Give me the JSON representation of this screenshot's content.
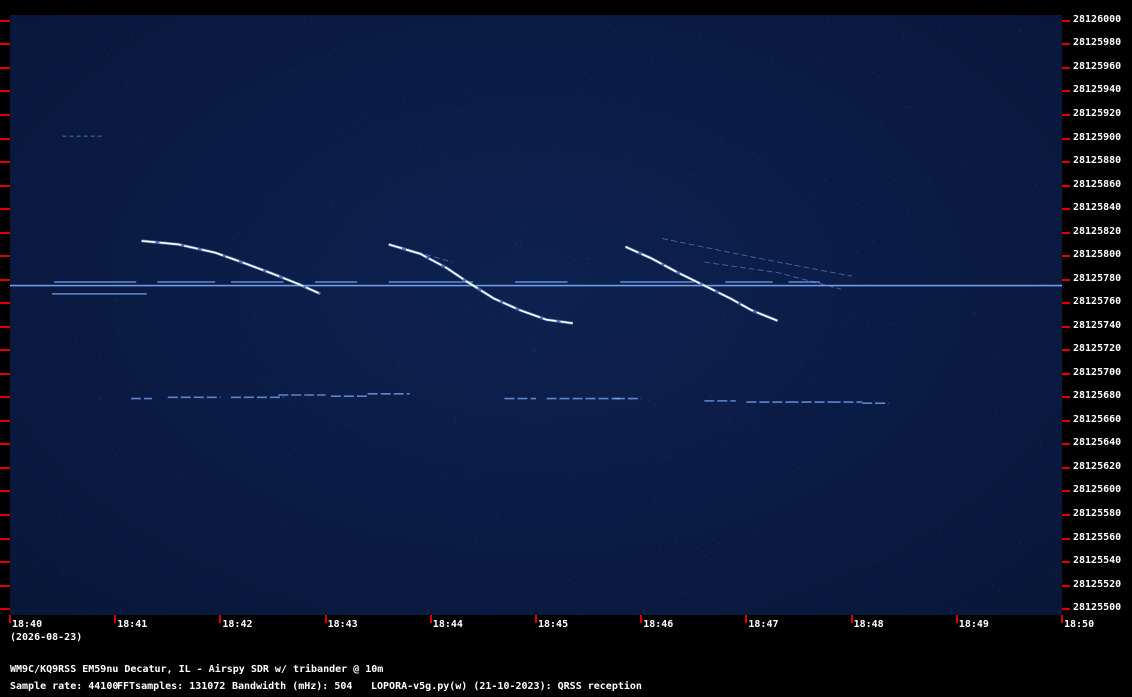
{
  "chart_data": {
    "type": "scatter",
    "x_ticks": [
      "18:40",
      "18:41",
      "18:42",
      "18:43",
      "18:44",
      "18:45",
      "18:46",
      "18:47",
      "18:48",
      "18:49",
      "18:50"
    ],
    "x_date": "(2026-08-23)",
    "y_ticks": [
      28126000,
      28125980,
      28125960,
      28125940,
      28125920,
      28125900,
      28125880,
      28125860,
      28125840,
      28125820,
      28125800,
      28125780,
      28125760,
      28125740,
      28125720,
      28125700,
      28125680,
      28125660,
      28125640,
      28125620,
      28125600,
      28125580,
      28125560,
      28125540,
      28125520,
      28125500
    ],
    "ylim": [
      28125495,
      28126005
    ],
    "xlim": [
      0,
      10
    ],
    "colors": {
      "background": "#0a1b44",
      "signal": "#7fb2ff",
      "bright": "#ffffff",
      "tick": "#e00000"
    },
    "carrier": {
      "freq": 28125775,
      "x_start": 0,
      "x_end": 10
    },
    "carrier_keying": [
      {
        "x0": 0.42,
        "x1": 1.2,
        "freq": 28125778
      },
      {
        "x0": 1.4,
        "x1": 1.95,
        "freq": 28125778
      },
      {
        "x0": 2.1,
        "x1": 2.6,
        "freq": 28125778
      },
      {
        "x0": 2.9,
        "x1": 3.3,
        "freq": 28125778
      },
      {
        "x0": 3.6,
        "x1": 4.4,
        "freq": 28125778
      },
      {
        "x0": 4.8,
        "x1": 5.3,
        "freq": 28125778
      },
      {
        "x0": 5.8,
        "x1": 6.5,
        "freq": 28125778
      },
      {
        "x0": 6.8,
        "x1": 7.25,
        "freq": 28125778
      },
      {
        "x0": 7.4,
        "x1": 7.7,
        "freq": 28125778
      },
      {
        "x0": 0.4,
        "x1": 1.3,
        "freq": 28125768
      }
    ],
    "descending_traces": [
      {
        "points": [
          [
            1.25,
            28125813
          ],
          [
            1.6,
            28125810
          ],
          [
            1.95,
            28125803
          ],
          [
            2.2,
            28125795
          ],
          [
            2.5,
            28125785
          ],
          [
            2.75,
            28125776
          ],
          [
            2.95,
            28125768
          ]
        ]
      },
      {
        "points": [
          [
            3.6,
            28125810
          ],
          [
            3.9,
            28125802
          ],
          [
            4.15,
            28125790
          ],
          [
            4.35,
            28125778
          ],
          [
            4.6,
            28125764
          ],
          [
            4.85,
            28125754
          ],
          [
            5.1,
            28125746
          ],
          [
            5.35,
            28125743
          ]
        ]
      },
      {
        "points": [
          [
            5.85,
            28125808
          ],
          [
            6.1,
            28125798
          ],
          [
            6.35,
            28125786
          ],
          [
            6.6,
            28125775
          ],
          [
            6.85,
            28125764
          ],
          [
            7.05,
            28125754
          ],
          [
            7.3,
            28125745
          ]
        ]
      }
    ],
    "faint_traces": [
      {
        "points": [
          [
            6.2,
            28125815
          ],
          [
            6.8,
            28125804
          ],
          [
            7.3,
            28125795
          ],
          [
            8.0,
            28125783
          ]
        ]
      },
      {
        "points": [
          [
            6.6,
            28125795
          ],
          [
            7.3,
            28125786
          ],
          [
            7.9,
            28125772
          ]
        ]
      },
      {
        "points": [
          [
            3.7,
            28125808
          ],
          [
            4.2,
            28125795
          ]
        ]
      }
    ],
    "lower_segments": [
      {
        "x0": 1.15,
        "x1": 1.35,
        "freq": 28125679
      },
      {
        "x0": 1.5,
        "x1": 2.0,
        "freq": 28125680
      },
      {
        "x0": 2.1,
        "x1": 2.6,
        "freq": 28125680
      },
      {
        "x0": 2.55,
        "x1": 3.0,
        "freq": 28125682
      },
      {
        "x0": 3.05,
        "x1": 3.4,
        "freq": 28125681
      },
      {
        "x0": 3.4,
        "x1": 3.8,
        "freq": 28125683
      },
      {
        "x0": 4.7,
        "x1": 5.0,
        "freq": 28125679
      },
      {
        "x0": 5.1,
        "x1": 5.8,
        "freq": 28125679
      },
      {
        "x0": 5.75,
        "x1": 6.0,
        "freq": 28125679
      },
      {
        "x0": 6.6,
        "x1": 6.9,
        "freq": 28125677
      },
      {
        "x0": 7.0,
        "x1": 7.4,
        "freq": 28125676
      },
      {
        "x0": 7.4,
        "x1": 7.8,
        "freq": 28125676
      },
      {
        "x0": 7.8,
        "x1": 8.1,
        "freq": 28125676
      },
      {
        "x0": 8.1,
        "x1": 8.35,
        "freq": 28125675
      }
    ],
    "misc_marks": [
      {
        "x0": 0.5,
        "x1": 0.9,
        "freq": 28125902
      }
    ]
  },
  "footer": {
    "station": "WM9C/KQ9RSS EM59nu Decatur, IL - Airspy SDR w/ tribander @ 10m",
    "sample_rate": "Sample rate: 44100",
    "fft_samples": "FFTsamples: 131072",
    "bandwidth": "Bandwidth (mHz): 504",
    "software": "LOPORA-v5g.py(w) (21-10-2023): QRSS reception"
  }
}
